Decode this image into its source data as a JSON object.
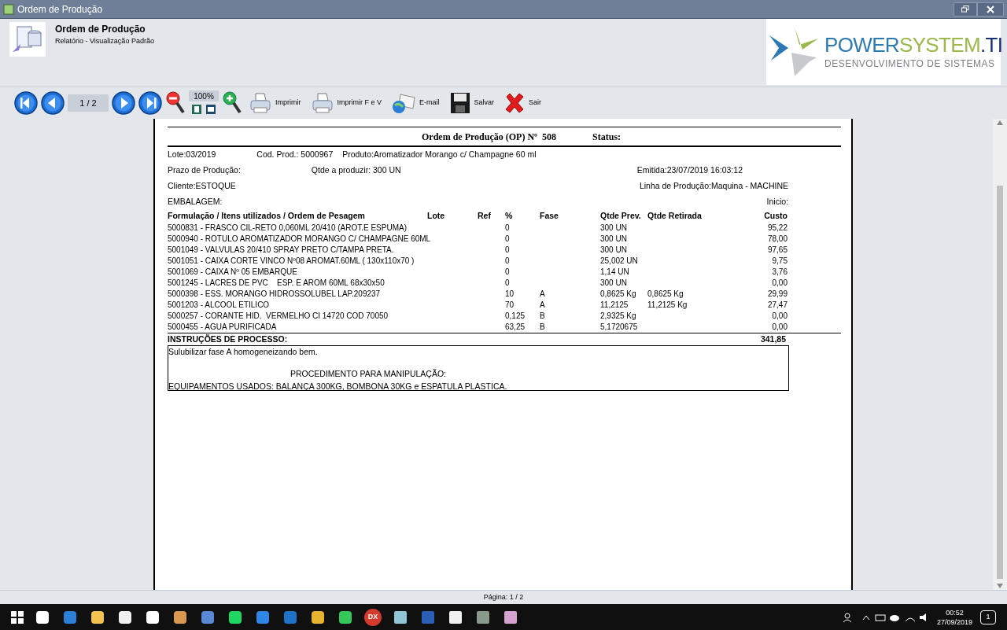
{
  "window": {
    "title": "Ordem de Produção"
  },
  "header": {
    "title": "Ordem de Produção",
    "subtitle": "Relatório - Visualização Padrão"
  },
  "logo": {
    "words": [
      "POWER",
      "SYSTEM",
      ".TI"
    ],
    "tagline": "DESENVOLVIMENTO DE SISTEMAS"
  },
  "toolbar": {
    "page": "1 / 2",
    "zoom": "100%",
    "actions": [
      {
        "kind": "print",
        "label": "Imprimir"
      },
      {
        "kind": "print",
        "label": "Imprimir F e V"
      },
      {
        "kind": "email",
        "label": "E-mail"
      },
      {
        "kind": "save",
        "label": "Salvar"
      },
      {
        "kind": "exit",
        "label": "Sair"
      }
    ]
  },
  "report": {
    "title": "Ordem de Produção (OP) Nº  508",
    "status_label": "Status:",
    "info_rows": [
      [
        "Lote:03/2019",
        "Cod. Prod.: 5000967",
        "Produto:Aromatizador Morango c/ Champagne 60 ml"
      ],
      [
        "Prazo de Produção:",
        "Qtde a produzir: 300 UN",
        "Emitida:23/07/2019 16:03:12"
      ],
      [
        "Cliente:ESTOQUE",
        "Linha de Produção:Maquina - MACHINE"
      ],
      [
        "EMBALAGEM:",
        "Inicio:"
      ]
    ],
    "columns": [
      "Formulação / Itens utilizados / Ordem de Pesagem",
      "Lote",
      "Ref",
      "%",
      "Fase",
      "Qtde Prev.",
      "Qtde Retirada",
      "Custo"
    ],
    "rows": [
      [
        "5000831 - FRASCO CIL-RETO 0,060ML 20/410 (AROT.E ESPUMA)",
        "",
        "",
        "0",
        "",
        "300 UN",
        "",
        "95,22"
      ],
      [
        "5000940 - ROTULO AROMATIZADOR MORANGO C/ CHAMPAGNE 60ML",
        "",
        "",
        "0",
        "",
        "300 UN",
        "",
        "78,00"
      ],
      [
        "5001049 - VALVULAS 20/410 SPRAY PRETO C/TAMPA PRETA.",
        "",
        "",
        "0",
        "",
        "300 UN",
        "",
        "97,65"
      ],
      [
        "5001051 - CAIXA CORTE VINCO Nº08 AROMAT.60ML ( 130x110x70 )",
        "",
        "",
        "0",
        "",
        "25,002 UN",
        "",
        "9,75"
      ],
      [
        "5001069 - CAIXA Nº 05 EMBARQUE",
        "",
        "",
        "0",
        "",
        "1,14 UN",
        "",
        "3,76"
      ],
      [
        "5001245 - LACRES DE PVC    ESP. E AROM 60ML 68x30x50",
        "",
        "",
        "0",
        "",
        "300 UN",
        "",
        "0,00"
      ],
      [
        "5000398 - ESS. MORANGO HIDROSSOLUBEL LAP.209237",
        "",
        "",
        "10",
        "A",
        "0,8625 Kg",
        "0,8625 Kg",
        "29,99"
      ],
      [
        "5001203 - ALCOOL ETILICO",
        "",
        "",
        "70",
        "A",
        "11,2125",
        "11,2125 Kg",
        "27,47"
      ],
      [
        "5000257 - CORANTE HID.  VERMELHO CI 14720 COD 70050",
        "",
        "",
        "0,125",
        "B",
        "2,9325 Kg",
        "",
        "0,00"
      ],
      [
        "5000455 - AGUA PURIFICADA",
        "",
        "",
        "63,25",
        "B",
        "5,1720675",
        "",
        "0,00"
      ]
    ],
    "instructions_label": "INSTRUÇÕES DE PROCESSO:",
    "total": "341,85",
    "instructions": {
      "first": "Sulubilizar fase A homogeneizando bem.",
      "heading": "PROCEDIMENTO PARA MANIPULAÇÃO:",
      "last": "EQUIPAMENTOS USADOS: BALANÇA 300KG, BOMBONA 30KG e ESPATULA PLASTICA."
    }
  },
  "status_bar": {
    "page": "Página: 1 / 2"
  },
  "taskbar": {
    "badge_text": "DX",
    "time": "00:52",
    "date": "27/09/2019",
    "notifications": "1"
  }
}
